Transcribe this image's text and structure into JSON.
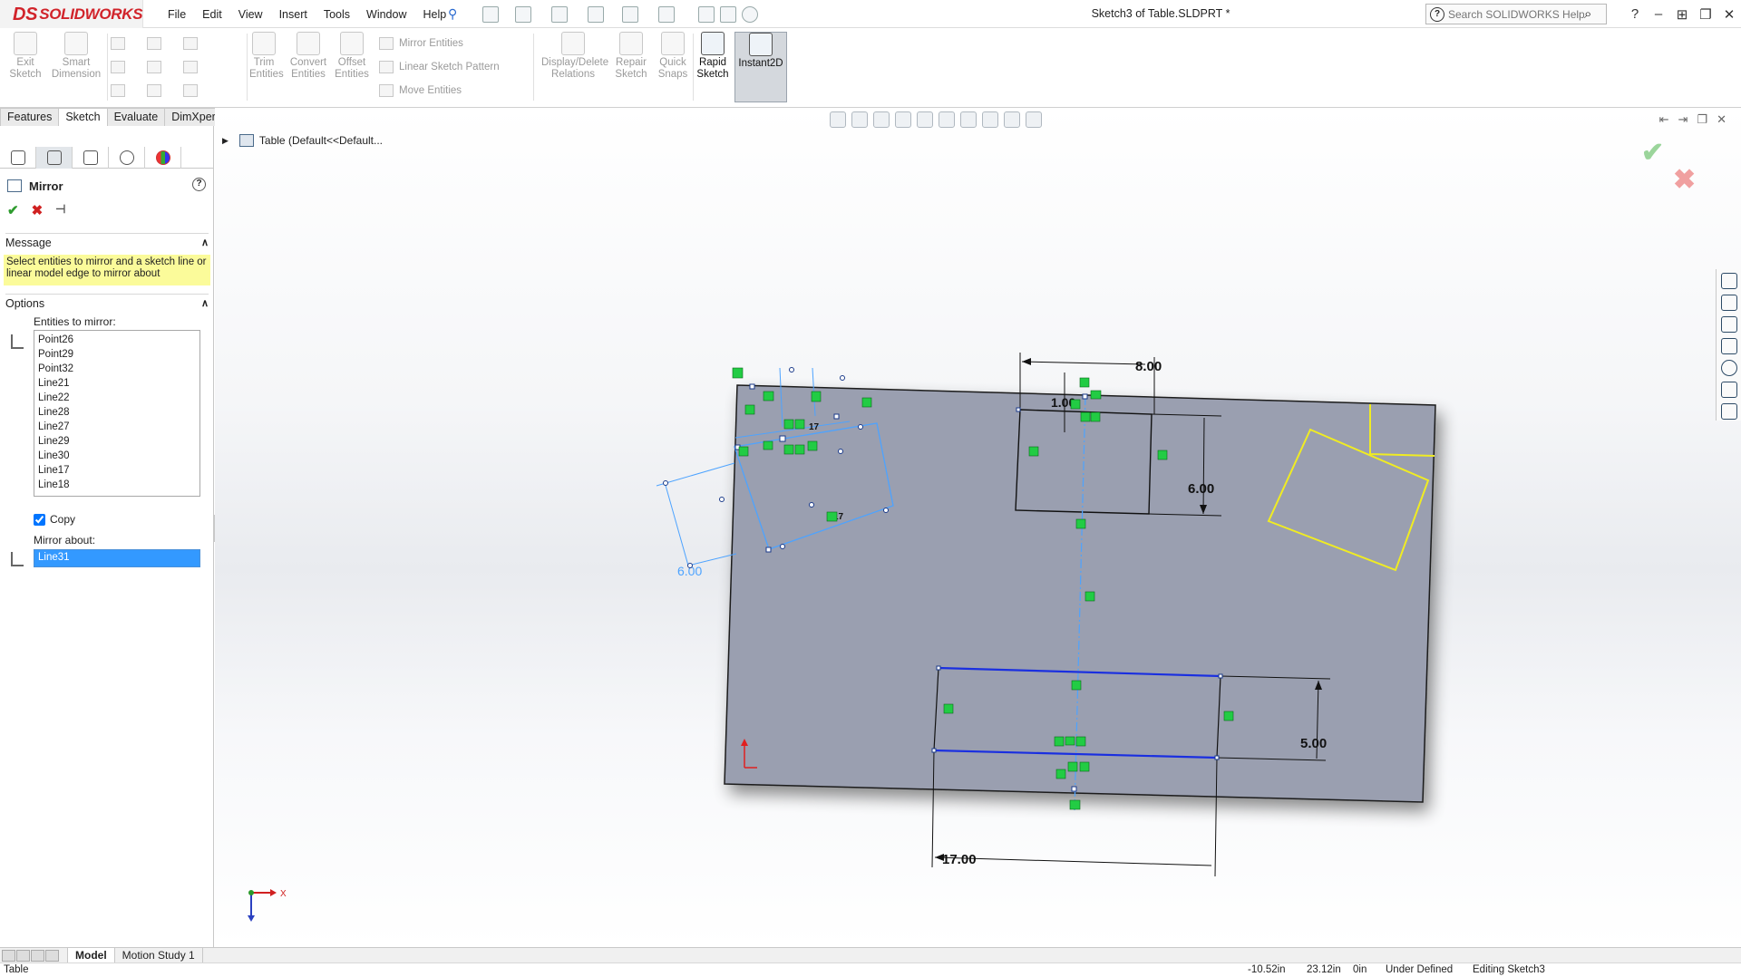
{
  "app": {
    "logo_text": "SOLIDWORKS",
    "logo_prefix": "DS"
  },
  "menu": [
    "File",
    "Edit",
    "View",
    "Insert",
    "Tools",
    "Window",
    "Help"
  ],
  "document_title": "Sketch3 of Table.SLDPRT *",
  "search": {
    "placeholder": "Search SOLIDWORKS Help"
  },
  "window_controls": [
    "?",
    "–",
    "⊞",
    "❐",
    "✕"
  ],
  "command_manager": {
    "exit_sketch": "Exit Sketch",
    "smart_dimension": "Smart Dimension",
    "trim_entities": "Trim Entities",
    "convert_entities": "Convert Entities",
    "offset_entities": "Offset Entities",
    "mirror_entities": "Mirror Entities",
    "linear_sketch_pattern": "Linear Sketch Pattern",
    "move_entities": "Move Entities",
    "display_delete_relations": "Display/Delete Relations",
    "repair_sketch": "Repair Sketch",
    "quick_snaps": "Quick Snaps",
    "rapid_sketch": "Rapid Sketch",
    "instant2d": "Instant2D"
  },
  "tabs": [
    "Features",
    "Sketch",
    "Evaluate",
    "DimXpert"
  ],
  "active_tab": "Sketch",
  "property_manager": {
    "title": "Mirror",
    "message_header": "Message",
    "message": "Select entities to mirror and a sketch line or linear model edge to mirror about",
    "options_header": "Options",
    "entities_label": "Entities to mirror:",
    "entities": [
      "Point26",
      "Point29",
      "Point32",
      "Line21",
      "Line22",
      "Line28",
      "Line27",
      "Line29",
      "Line30",
      "Line17",
      "Line18"
    ],
    "copy_label": "Copy",
    "copy_checked": true,
    "mirror_about_label": "Mirror about:",
    "mirror_about_value": "Line31"
  },
  "feature_tree_flyout": "Table  (Default<<Default...",
  "sketch": {
    "dim_top_width": "8.00",
    "dim_top_offset": "1.00",
    "dim_top_height": "6.00",
    "dim_bottom_width": "17.00",
    "dim_bottom_height": "5.00",
    "dim_preview_a": "6.00",
    "dim_preview_b": "17",
    "dim_preview_c": "17",
    "triad_x": "X"
  },
  "colors": {
    "sheet": "#9a9fb0",
    "selected": "#1a2fe0",
    "preview": "#4da3ff",
    "relation": "#22cc44",
    "highlight_rect": "#f0ec22"
  },
  "bottom_tabs": [
    "Model",
    "Motion Study 1"
  ],
  "active_bottom_tab": "Model",
  "status": {
    "left": "Table",
    "x": "-10.52in",
    "y": "23.12in",
    "z": "0in",
    "state": "Under Defined",
    "editing": "Editing Sketch3"
  }
}
